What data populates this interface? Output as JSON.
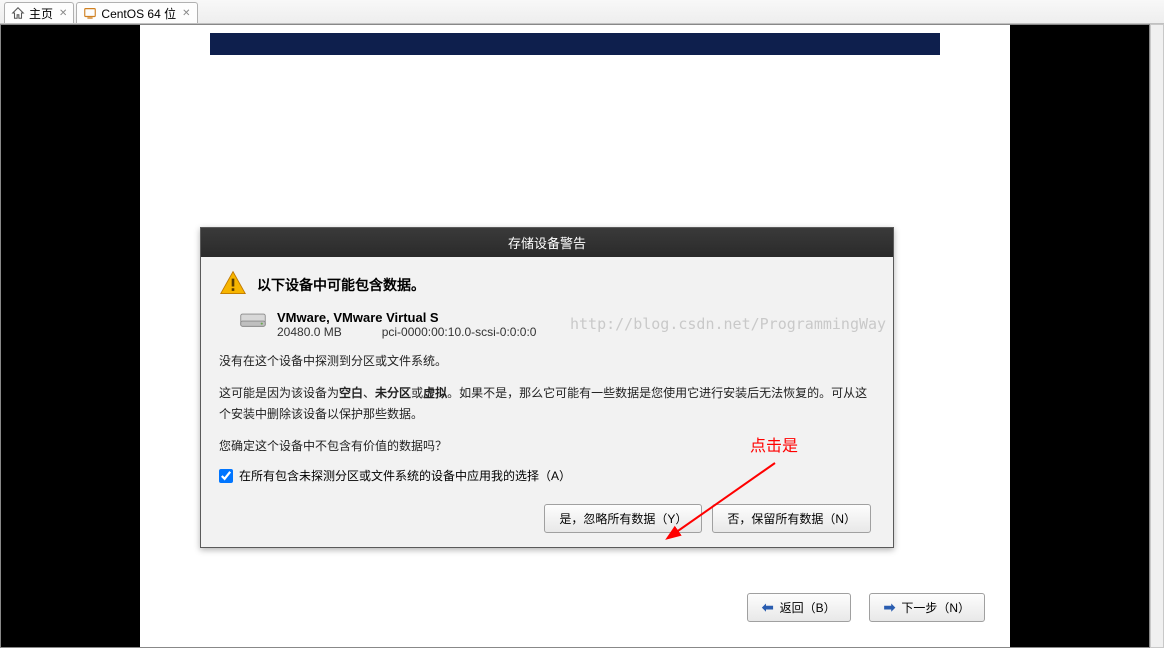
{
  "tabs": [
    {
      "label": "主页",
      "icon": "home-icon"
    },
    {
      "label": "CentOS 64 位",
      "icon": "vm-icon"
    }
  ],
  "dialog": {
    "title": "存储设备警告",
    "warning_heading": "以下设备中可能包含数据。",
    "device": {
      "name": "VMware, VMware Virtual S",
      "size": "20480.0 MB",
      "path": "pci-0000:00:10.0-scsi-0:0:0:0"
    },
    "para1": "没有在这个设备中探测到分区或文件系统。",
    "para2_pre": "这可能是因为该设备为",
    "para2_b1": "空白",
    "para2_sep1": "、",
    "para2_b2": "未分区",
    "para2_sep2": "或",
    "para2_b3": "虚拟",
    "para2_post": "。如果不是，那么它可能有一些数据是您使用它进行安装后无法恢复的。可从这个安装中删除该设备以保护那些数据。",
    "para3": "您确定这个设备中不包含有价值的数据吗？",
    "checkbox_label": "在所有包含未探测分区或文件系统的设备中应用我的选择（A）",
    "btn_yes": "是，忽略所有数据（Y）",
    "btn_no": "否，保留所有数据（N）"
  },
  "nav": {
    "back": "返回（B）",
    "next": "下一步（N）"
  },
  "watermark": "http://blog.csdn.net/ProgrammingWay",
  "annotation": "点击是"
}
